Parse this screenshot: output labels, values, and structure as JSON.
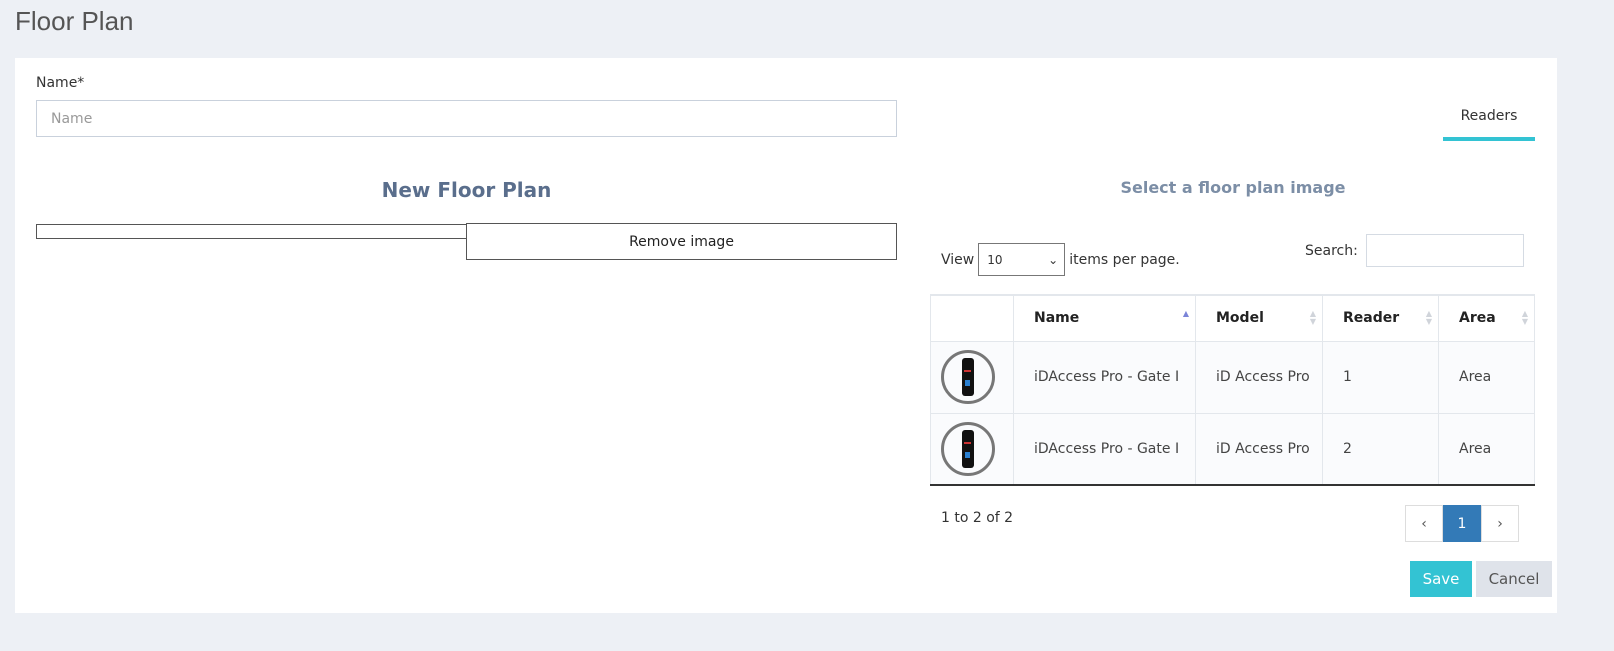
{
  "page": {
    "title": "Floor Plan"
  },
  "form": {
    "name_label": "Name*",
    "name_placeholder": "Name",
    "name_value": ""
  },
  "tabs": [
    {
      "label": "Readers",
      "active": true
    }
  ],
  "left": {
    "heading": "New Floor Plan",
    "remove_label": "Remove image"
  },
  "right": {
    "heading": "Select a floor plan image",
    "view_label": "View",
    "page_size": "10",
    "per_page_label": "items per page.",
    "search_label": "Search:",
    "search_value": ""
  },
  "table": {
    "columns": [
      "",
      "Name",
      "Model",
      "Reader",
      "Area"
    ],
    "sort": {
      "column": "Name",
      "direction": "asc"
    },
    "rows": [
      {
        "icon": "reader-device-icon",
        "name": "iDAccess Pro - Gate I",
        "model": "iD Access Pro",
        "reader": "1",
        "area": "Area"
      },
      {
        "icon": "reader-device-icon",
        "name": "iDAccess Pro - Gate I",
        "model": "iD Access Pro",
        "reader": "2",
        "area": "Area"
      }
    ]
  },
  "pagination": {
    "summary": "1 to 2 of 2",
    "prev": "‹",
    "current": "1",
    "next": "›"
  },
  "actions": {
    "save": "Save",
    "cancel": "Cancel"
  },
  "colors": {
    "accent": "#33c3d3",
    "pager_active": "#337ab7",
    "background": "#edf0f5"
  }
}
